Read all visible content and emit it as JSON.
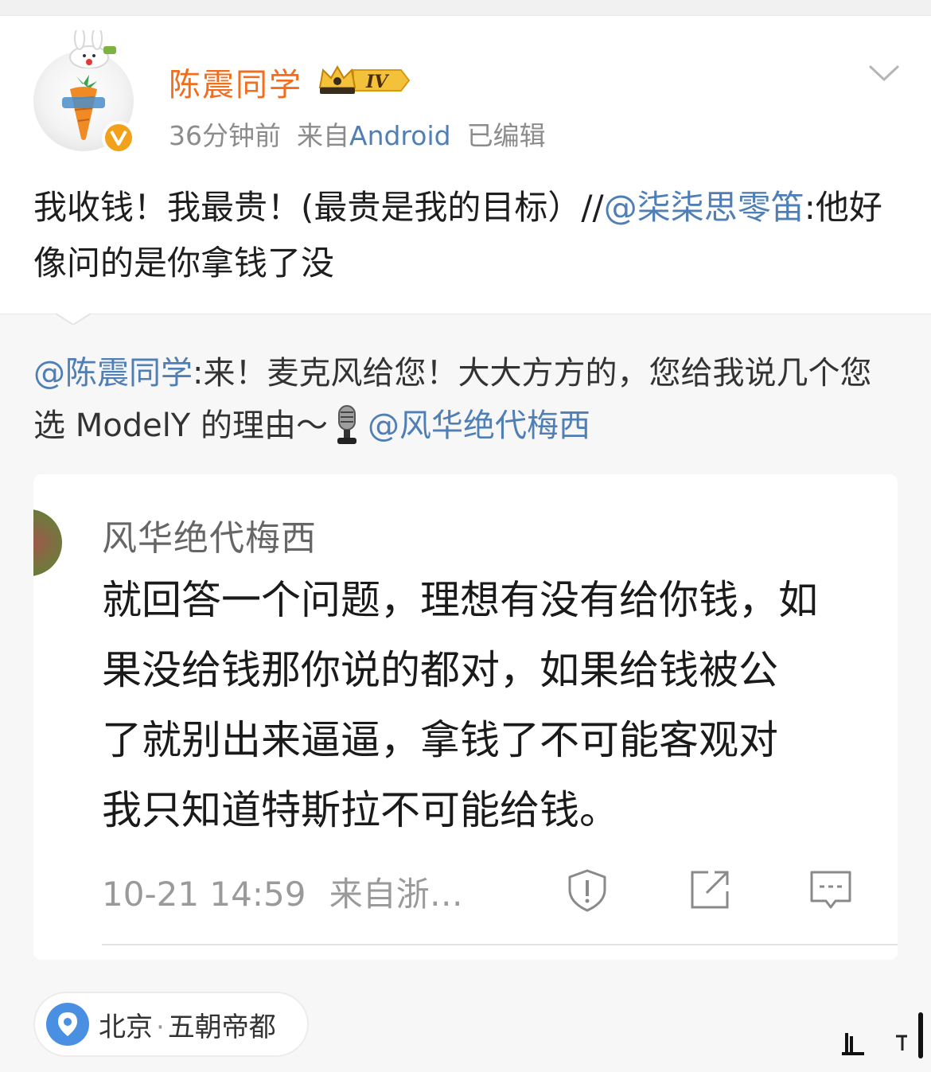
{
  "post": {
    "username": "陈震同学",
    "vip_level": "IV",
    "time": "36分钟前",
    "source_prefix": "来自",
    "source": "Android",
    "edited": "已编辑",
    "text_main": "我收钱！我最贵！(最贵是我的目标）//",
    "mention": "@柒柒思零笛",
    "text_after": ":他好像问的是你拿钱了没"
  },
  "repost": {
    "mention_author": "@陈震同学",
    "text": ":来！麦克风给您！大大方方的，您给我说几个您选 ModelY 的理由～",
    "mention_target": "@风华绝代梅西"
  },
  "quoted_card": {
    "author": "风华绝代梅西",
    "lines": [
      "就回答一个问题，理想有没有给你钱，如",
      "果没给钱那你说的都对，如果给钱被公",
      "了就别出来逼逼，拿钱了不可能客观对",
      "我只知道特斯拉不可能给钱。"
    ],
    "time": "10-21 14:59",
    "source": "来自浙…"
  },
  "location": {
    "city": "北京",
    "separator": "·",
    "tagline": "五朝帝都"
  },
  "colors": {
    "username": "#f26e1c",
    "link": "#4f7fb5",
    "badge": "#f2a11a",
    "pin": "#4a90e2"
  },
  "icons": [
    "chevron-down-icon",
    "crown-vip-icon",
    "verified-v-icon",
    "microphone-icon",
    "report-icon",
    "share-icon",
    "comment-icon",
    "location-pin-icon"
  ]
}
